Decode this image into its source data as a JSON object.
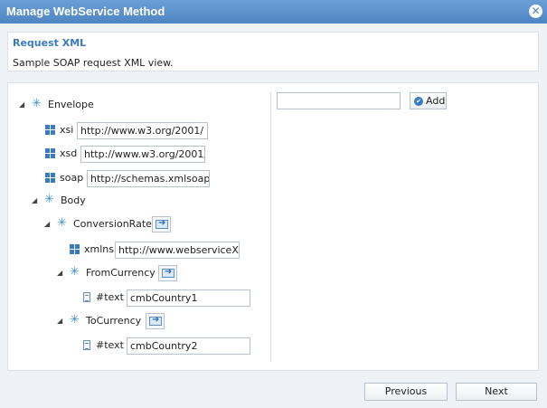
{
  "window": {
    "title": "Manage WebService Method",
    "close_icon": "close-circle-icon"
  },
  "header": {
    "title": "Request XML",
    "description": "Sample SOAP request XML view."
  },
  "tree": {
    "envelope": {
      "label": "Envelope"
    },
    "xsi": {
      "label": "xsi",
      "value": "http://www.w3.org/2001/"
    },
    "xsd": {
      "label": "xsd",
      "value": "http://www.w3.org/2001/"
    },
    "soap": {
      "label": "soap",
      "value": "http://schemas.xmlsoap.o"
    },
    "body": {
      "label": "Body"
    },
    "conversion_rate": {
      "label": "ConversionRate"
    },
    "xmlns": {
      "label": "xmlns",
      "value": "http://www.webserviceX."
    },
    "from_currency": {
      "label": "FromCurrency"
    },
    "from_text": {
      "label": "#text",
      "value": "cmbCountry1"
    },
    "to_currency": {
      "label": "ToCurrency"
    },
    "to_text": {
      "label": "#text",
      "value": "cmbCountry2"
    }
  },
  "right_panel": {
    "input_value": "",
    "add_label": "Add"
  },
  "footer": {
    "previous_label": "Previous",
    "next_label": "Next"
  },
  "colors": {
    "titlebar": "#5a8fcc",
    "accent": "#3a7bbf"
  }
}
